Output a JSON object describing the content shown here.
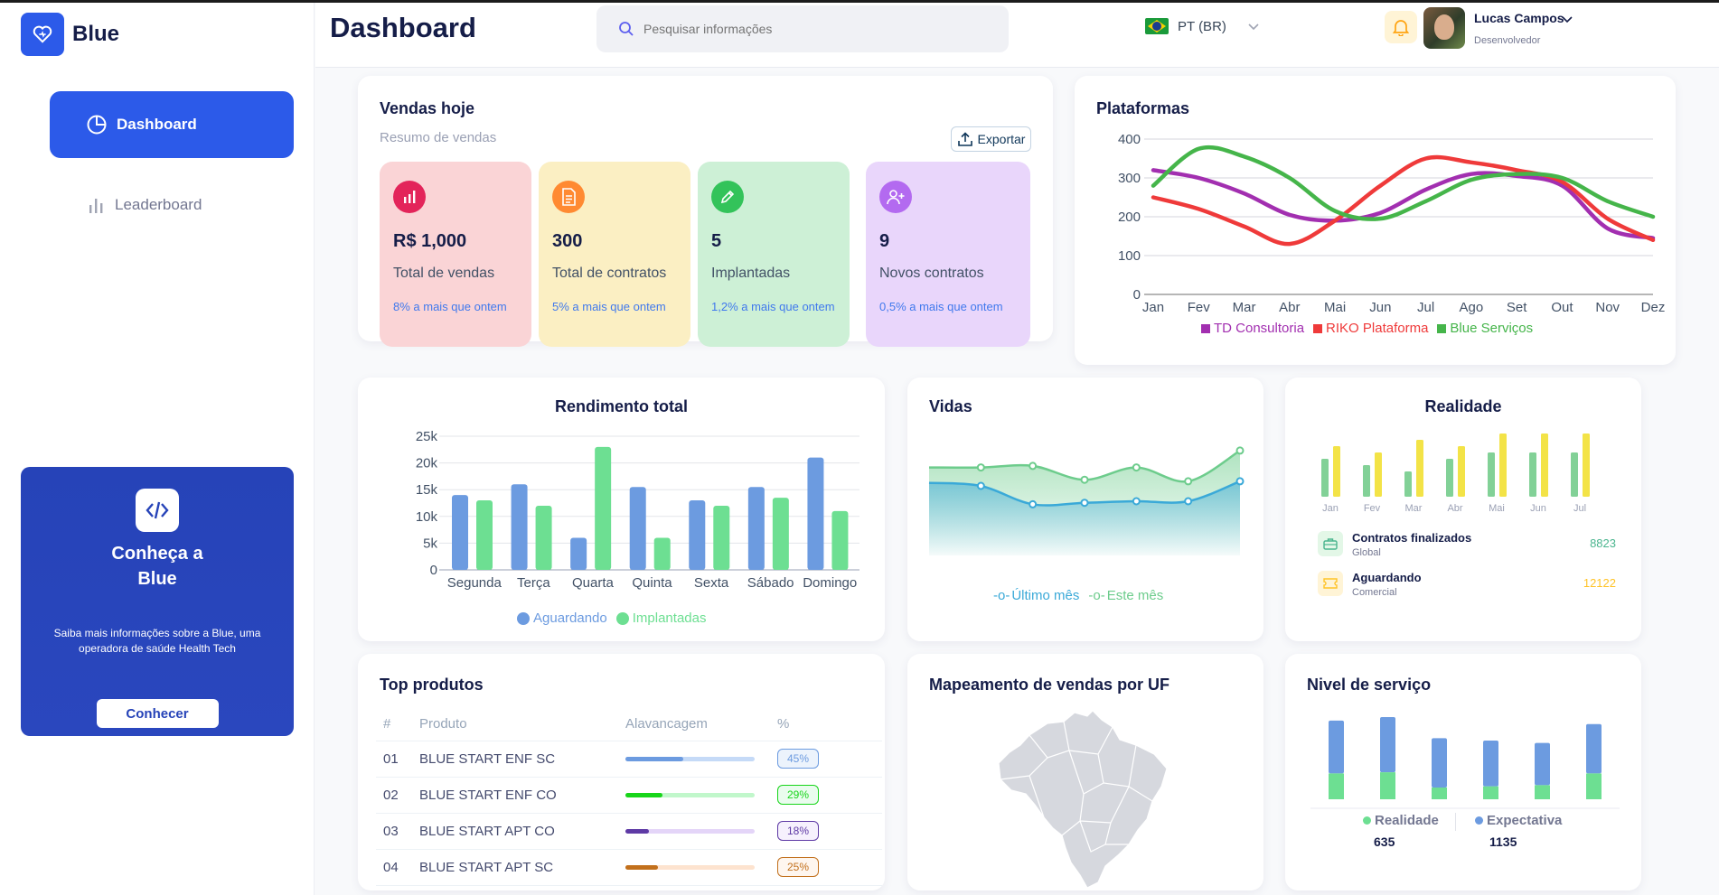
{
  "brand": {
    "name": "Blue"
  },
  "sidebar": {
    "items": [
      {
        "label": "Dashboard",
        "active": true,
        "icon": "pie-chart-icon"
      },
      {
        "label": "Leaderboard",
        "active": false,
        "icon": "bar-chart-icon"
      }
    ],
    "promo": {
      "title": "Conheça a Blue",
      "text": "Saiba mais informações sobre a Blue, uma operadora de saúde Health Tech",
      "button": "Conhecer"
    }
  },
  "header": {
    "title": "Dashboard",
    "search_placeholder": "Pesquisar informações",
    "language": "PT (BR)",
    "user": {
      "name": "Lucas Campos",
      "role": "Desenvolvedor"
    }
  },
  "sales_today": {
    "title": "Vendas hoje",
    "subtitle": "Resumo de vendas",
    "export_label": "Exportar",
    "stats": [
      {
        "value": "R$ 1,000",
        "label": "Total de vendas",
        "change": "8% a mais que ontem",
        "bg": "#fad4d6",
        "icon_bg": "#e3245a",
        "icon": "bar-chart-icon"
      },
      {
        "value": "300",
        "label": "Total de contratos",
        "change": "5% a mais que ontem",
        "bg": "#fbefc3",
        "icon_bg": "#ff8a32",
        "icon": "document-icon"
      },
      {
        "value": "5",
        "label": "Implantadas",
        "change": "1,2% a mais que ontem",
        "bg": "#cdf0d6",
        "icon_bg": "#33c35a",
        "icon": "pencil-icon"
      },
      {
        "value": "9",
        "label": "Novos contratos",
        "change": "0,5% a mais que ontem",
        "bg": "#e9d6fb",
        "icon_bg": "#b36af0",
        "icon": "add-user-icon"
      }
    ]
  },
  "platforms": {
    "title": "Plataformas",
    "chart_data": {
      "type": "line",
      "x": [
        "Jan",
        "Fev",
        "Mar",
        "Abr",
        "Mai",
        "Jun",
        "Jul",
        "Ago",
        "Set",
        "Out",
        "Nov",
        "Dez"
      ],
      "yticks": [
        0,
        100,
        200,
        300,
        400
      ],
      "ylim": [
        0,
        400
      ],
      "series": [
        {
          "name": "TD Consultoria",
          "color": "#a22fb0",
          "values": [
            320,
            300,
            260,
            205,
            190,
            210,
            270,
            310,
            305,
            280,
            170,
            145
          ]
        },
        {
          "name": "RIKO Plataforma",
          "color": "#ef3a3a",
          "values": [
            250,
            220,
            175,
            130,
            190,
            280,
            350,
            340,
            320,
            290,
            195,
            140
          ]
        },
        {
          "name": "Blue Serviços",
          "color": "#45b54a",
          "values": [
            280,
            375,
            355,
            300,
            215,
            195,
            240,
            295,
            310,
            300,
            240,
            200
          ]
        }
      ]
    }
  },
  "revenue": {
    "title": "Rendimento total",
    "chart_data": {
      "type": "bar",
      "categories": [
        "Segunda",
        "Terça",
        "Quarta",
        "Quinta",
        "Sexta",
        "Sábado",
        "Domingo"
      ],
      "yticks": [
        "0",
        "5k",
        "10k",
        "15k",
        "20k",
        "25k"
      ],
      "ylim": [
        0,
        25000
      ],
      "series": [
        {
          "name": "Aguardando",
          "color": "#6c9be0",
          "values": [
            14000,
            16000,
            6000,
            15500,
            13000,
            15500,
            21000
          ]
        },
        {
          "name": "Implantadas",
          "color": "#6ddf92",
          "values": [
            13000,
            12000,
            23000,
            6000,
            12000,
            13500,
            11000
          ]
        }
      ]
    }
  },
  "lives": {
    "title": "Vidas",
    "chart_data": {
      "type": "area",
      "series": [
        {
          "name": "Último mês",
          "color": "#3aa9d8",
          "values": [
            62,
            60,
            48,
            49,
            50,
            50,
            63
          ]
        },
        {
          "name": "Este mês",
          "color": "#6dcc8c",
          "values": [
            72,
            72,
            73,
            64,
            72,
            63,
            83
          ]
        }
      ]
    }
  },
  "reality": {
    "title": "Realidade",
    "chart_data": {
      "type": "bar",
      "categories": [
        "Jan",
        "Fev",
        "Mar",
        "Abr",
        "Mai",
        "Jun",
        "Jul"
      ],
      "series": [
        {
          "name": "Contratos finalizados",
          "color": "#82d197",
          "values": [
            6,
            5,
            4,
            6,
            7,
            7,
            7
          ]
        },
        {
          "name": "Aguardando",
          "color": "#f3e347",
          "values": [
            8,
            7,
            9,
            8,
            10,
            10,
            10
          ]
        }
      ]
    },
    "rows": [
      {
        "title": "Contratos finalizados",
        "sub": "Global",
        "value": "8823",
        "color": "#4ab58e",
        "icon": "briefcase-icon",
        "icon_bg": "#e3f7e7"
      },
      {
        "title": "Aguardando",
        "sub": "Comercial",
        "value": "12122",
        "color": "#ffc327",
        "icon": "ticket-icon",
        "icon_bg": "#fff4d6"
      }
    ]
  },
  "top_products": {
    "title": "Top produtos",
    "columns": [
      "#",
      "Produto",
      "Alavancagem",
      "%"
    ],
    "rows": [
      {
        "id": "01",
        "name": "BLUE START ENF SC",
        "pct": "45%",
        "value": 45,
        "color": "#6c9be0",
        "track": "#c5daf7"
      },
      {
        "id": "02",
        "name": "BLUE START ENF CO",
        "pct": "29%",
        "value": 29,
        "color": "#18d51a",
        "track": "#c1f7cb"
      },
      {
        "id": "03",
        "name": "BLUE START APT CO",
        "pct": "18%",
        "value": 18,
        "color": "#5e3aa5",
        "track": "#e4d5f8"
      },
      {
        "id": "04",
        "name": "BLUE START APT SC",
        "pct": "25%",
        "value": 25,
        "color": "#c2701c",
        "track": "#fde3cf"
      }
    ]
  },
  "map": {
    "title": "Mapeamento de vendas por UF"
  },
  "service_level": {
    "title": "Nivel de serviço",
    "chart_data": {
      "type": "bar",
      "stacked": true,
      "series": [
        {
          "name": "Realidade",
          "color": "#6ddf92",
          "values": [
            22,
            23,
            10,
            11,
            12,
            22
          ]
        },
        {
          "name": "Expectativa",
          "color": "#6c9be0",
          "values": [
            45,
            47,
            42,
            39,
            36,
            42
          ]
        }
      ],
      "totals": [
        {
          "name": "Realidade",
          "value": "635"
        },
        {
          "name": "Expectativa",
          "value": "1135"
        }
      ]
    }
  }
}
